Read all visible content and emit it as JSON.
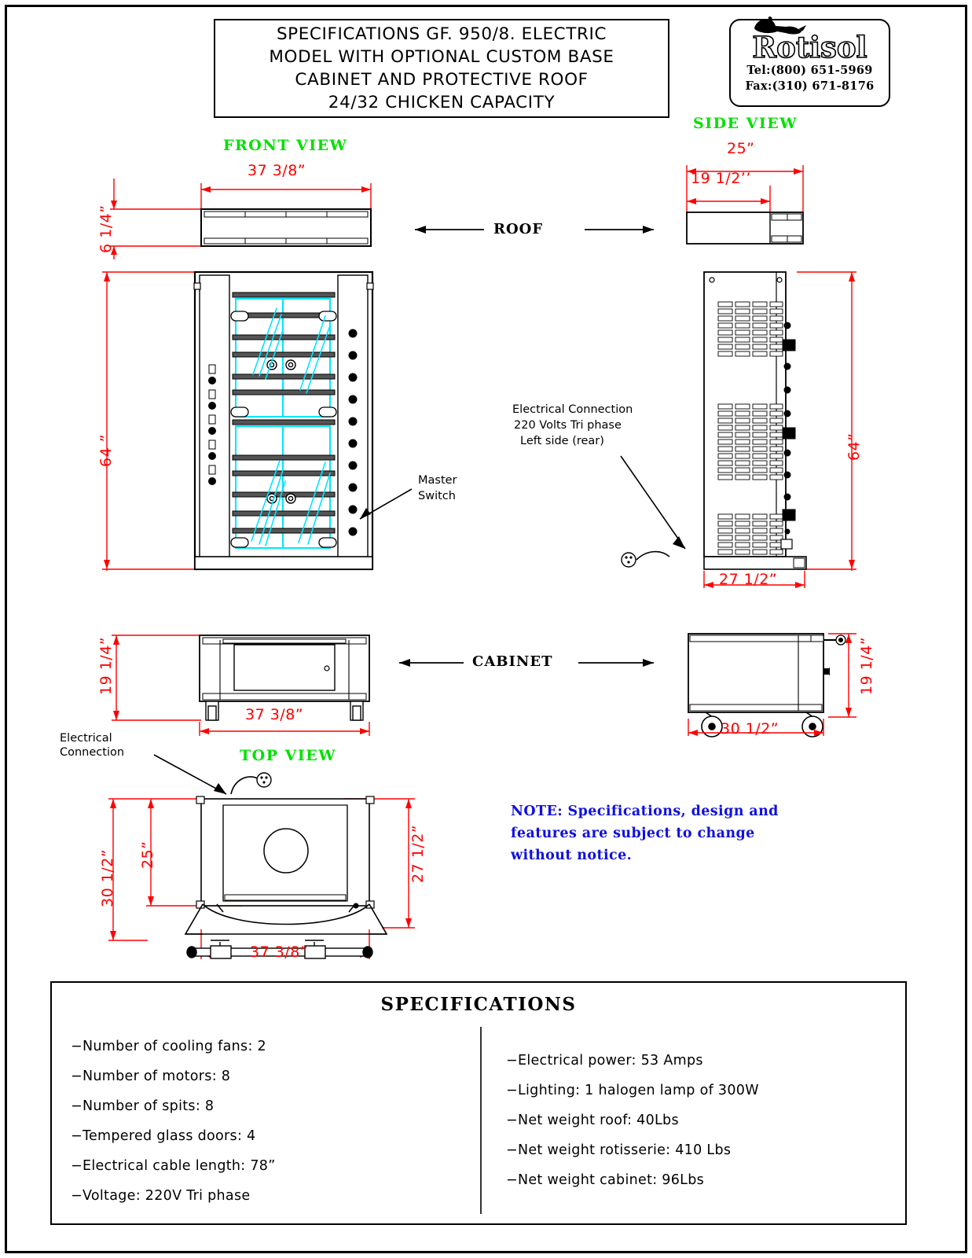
{
  "title_block": {
    "lines": [
      "SPECIFICATIONS GF. 950/8. ELECTRIC",
      "MODEL WITH OPTIONAL CUSTOM BASE",
      "CABINET AND PROTECTIVE ROOF",
      "24/32 CHICKEN CAPACITY"
    ]
  },
  "logo": {
    "brand": "Rotisol",
    "tel": "Tel:(800) 651-5969",
    "fax": "Fax:(310) 671-8176"
  },
  "view_labels": {
    "front": "FRONT  VIEW",
    "side": "SIDE VIEW",
    "top": "TOP   VIEW",
    "roof": "ROOF",
    "cabinet": "CABINET"
  },
  "dimensions": {
    "roof_front_width": "37 3/8”",
    "roof_front_height": "6 1/4”",
    "roof_side_width": "25”",
    "roof_side_inner": "19 1/2’’",
    "body_front_height": "64 ”",
    "body_side_height": "64”",
    "body_side_depth": "27 1/2”",
    "cabinet_front_height": "19 1/4”",
    "cabinet_front_width": "37 3/8”",
    "cabinet_side_height": "19 1/4”",
    "cabinet_side_width": "30 1/2”",
    "top_outer_depth": "30 1/2”",
    "top_inner_depth": "25”",
    "top_right_depth": "27 1/2”",
    "top_width": "37 3/8”"
  },
  "annotations": {
    "master_switch": [
      "Master",
      "Switch"
    ],
    "electrical_rear": [
      "Electrical Connection",
      "220 Volts Tri phase",
      "Left side (rear)"
    ],
    "electrical_top": [
      "Electrical",
      "Connection"
    ]
  },
  "note": {
    "lines": [
      "NOTE: Specifications, design and",
      "features are subject to change",
      "without notice."
    ]
  },
  "specifications": {
    "heading": "SPECIFICATIONS",
    "left_items": [
      "−Number of cooling fans: 2",
      "−Number of motors: 8",
      "−Number of spits: 8",
      "−Tempered glass doors: 4",
      "−Electrical cable length: 78”",
      "−Voltage: 220V Tri phase"
    ],
    "right_items": [
      "−Electrical power: 53 Amps",
      "−Lighting: 1 halogen lamp of 300W",
      "−Net weight roof: 40Lbs",
      "−Net weight rotisserie: 410 Lbs",
      "−Net weight cabinet: 96Lbs"
    ]
  },
  "colors": {
    "dimension_red": "#ff0000",
    "view_label_green": "#00e000",
    "note_blue": "#1010e0",
    "glass_cyan": "#00e5ff",
    "line_black": "#000000"
  }
}
